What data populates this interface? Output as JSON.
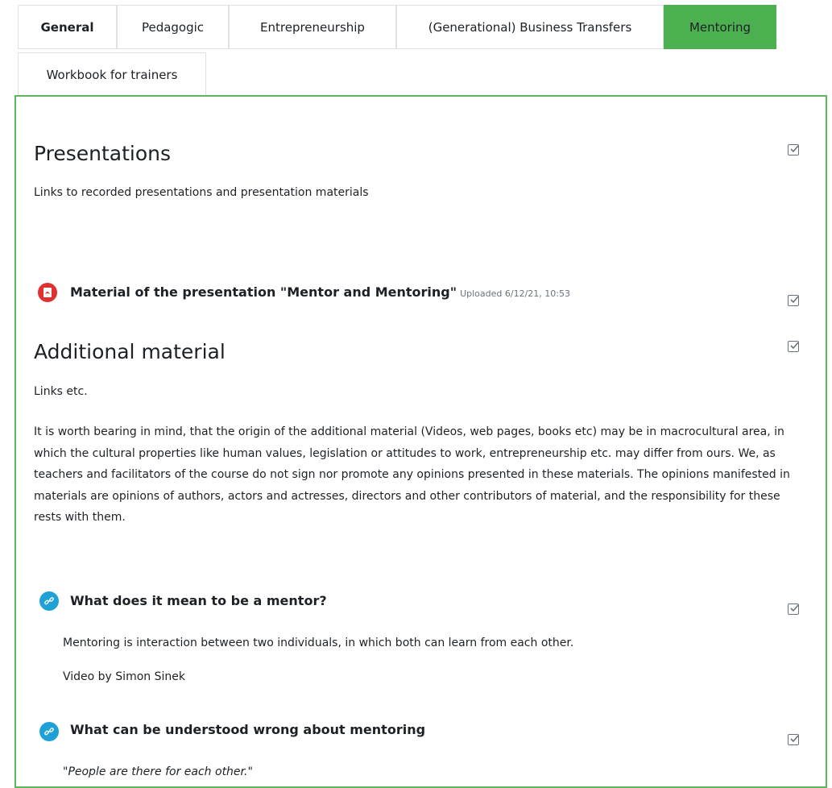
{
  "tabs": [
    {
      "label": "General"
    },
    {
      "label": "Pedagogic"
    },
    {
      "label": "Entrepreneurship"
    },
    {
      "label": "(Generational) Business Transfers"
    },
    {
      "label": "Mentoring"
    },
    {
      "label": "Workbook for trainers"
    }
  ],
  "colors": {
    "accent": "#4caf50",
    "panel_border": "#5cb85c",
    "pdf_icon": "#e0302f",
    "url_icon": "#1fa1d8"
  },
  "sections": {
    "presentations": {
      "title": "Presentations",
      "summary": "Links to recorded presentations and presentation materials",
      "activity": {
        "icon": "pdf-icon",
        "title": "Material of the presentation \"Mentor and Mentoring\"",
        "meta": "Uploaded 6/12/21, 10:53"
      }
    },
    "additional": {
      "title": "Additional material",
      "summary": "Links etc.",
      "disclaimer": "It is worth bearing in mind, that the origin of the additional material (Videos, web pages, books etc) may be in macrocultural area, in which the cultural properties like human values, legislation or attitudes to work, entrepreneurship etc. may differ from ours.  We, as teachers and facilitators of the course do not sign nor promote any opinions presented in these materials. The opinions manifested in materials are opinions of authors, actors and actresses, directors and other contributors of material, and the responsibility for these rests with them.",
      "activities": [
        {
          "icon": "link-icon",
          "title": "What does it mean to be a mentor?",
          "description": "Mentoring is interaction between two individuals, in which both can learn from each other.",
          "credit": "Video by Simon Sinek"
        },
        {
          "icon": "link-icon",
          "title": "What can be understood wrong about mentoring",
          "quote": "\"People are there for each other.\""
        }
      ]
    }
  }
}
